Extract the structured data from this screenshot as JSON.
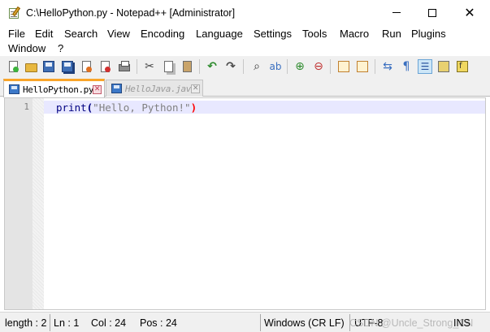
{
  "window": {
    "title": "C:\\HelloPython.py - Notepad++ [Administrator]",
    "minimize_glyph": "",
    "maximize_glyph": "",
    "close_glyph": "✕"
  },
  "menu": {
    "items": [
      "File",
      "Edit",
      "Search",
      "View",
      "Encoding",
      "Language",
      "Settings",
      "Tools",
      "Macro",
      "Run",
      "Plugins",
      "Window",
      "?"
    ]
  },
  "toolbar": {
    "icons": [
      "new-file-icon",
      "open-file-icon",
      "save-icon",
      "save-all-icon",
      "close-icon",
      "close-all-icon",
      "print-icon",
      "cut-icon",
      "copy-icon",
      "paste-icon",
      "undo-icon",
      "redo-icon",
      "find-icon",
      "replace-icon",
      "zoom-in-icon",
      "zoom-out-icon",
      "sync-vertical-icon",
      "sync-horizontal-icon",
      "word-wrap-icon",
      "show-all-chars-icon",
      "indent-guide-icon",
      "doc-map-icon",
      "function-list-icon"
    ],
    "colors": {
      "undo": "#2e8b2e",
      "redo": "#4a4a4a",
      "accent": "#f9a52a"
    }
  },
  "tabs": [
    {
      "label": "HelloPython.py",
      "active": true
    },
    {
      "label": "HelloJava.java",
      "active": false
    }
  ],
  "editor": {
    "line_numbers": [
      "1"
    ],
    "code": {
      "func": "print",
      "open": "(",
      "string": "\"Hello, Python!\"",
      "close": ")"
    },
    "colors": {
      "keyword": "#000080",
      "string": "#808080",
      "brace_match": "#ff0000",
      "current_line": "#e8e8ff"
    }
  },
  "statusbar": {
    "length": "length : 2",
    "line": "Ln : 1",
    "col": "Col : 24",
    "pos": "Pos : 24",
    "eol": "Windows (CR LF)",
    "encoding": "UTF-8",
    "mode": "INS",
    "watermark": "CSDN @Uncle_Strong_CN"
  }
}
